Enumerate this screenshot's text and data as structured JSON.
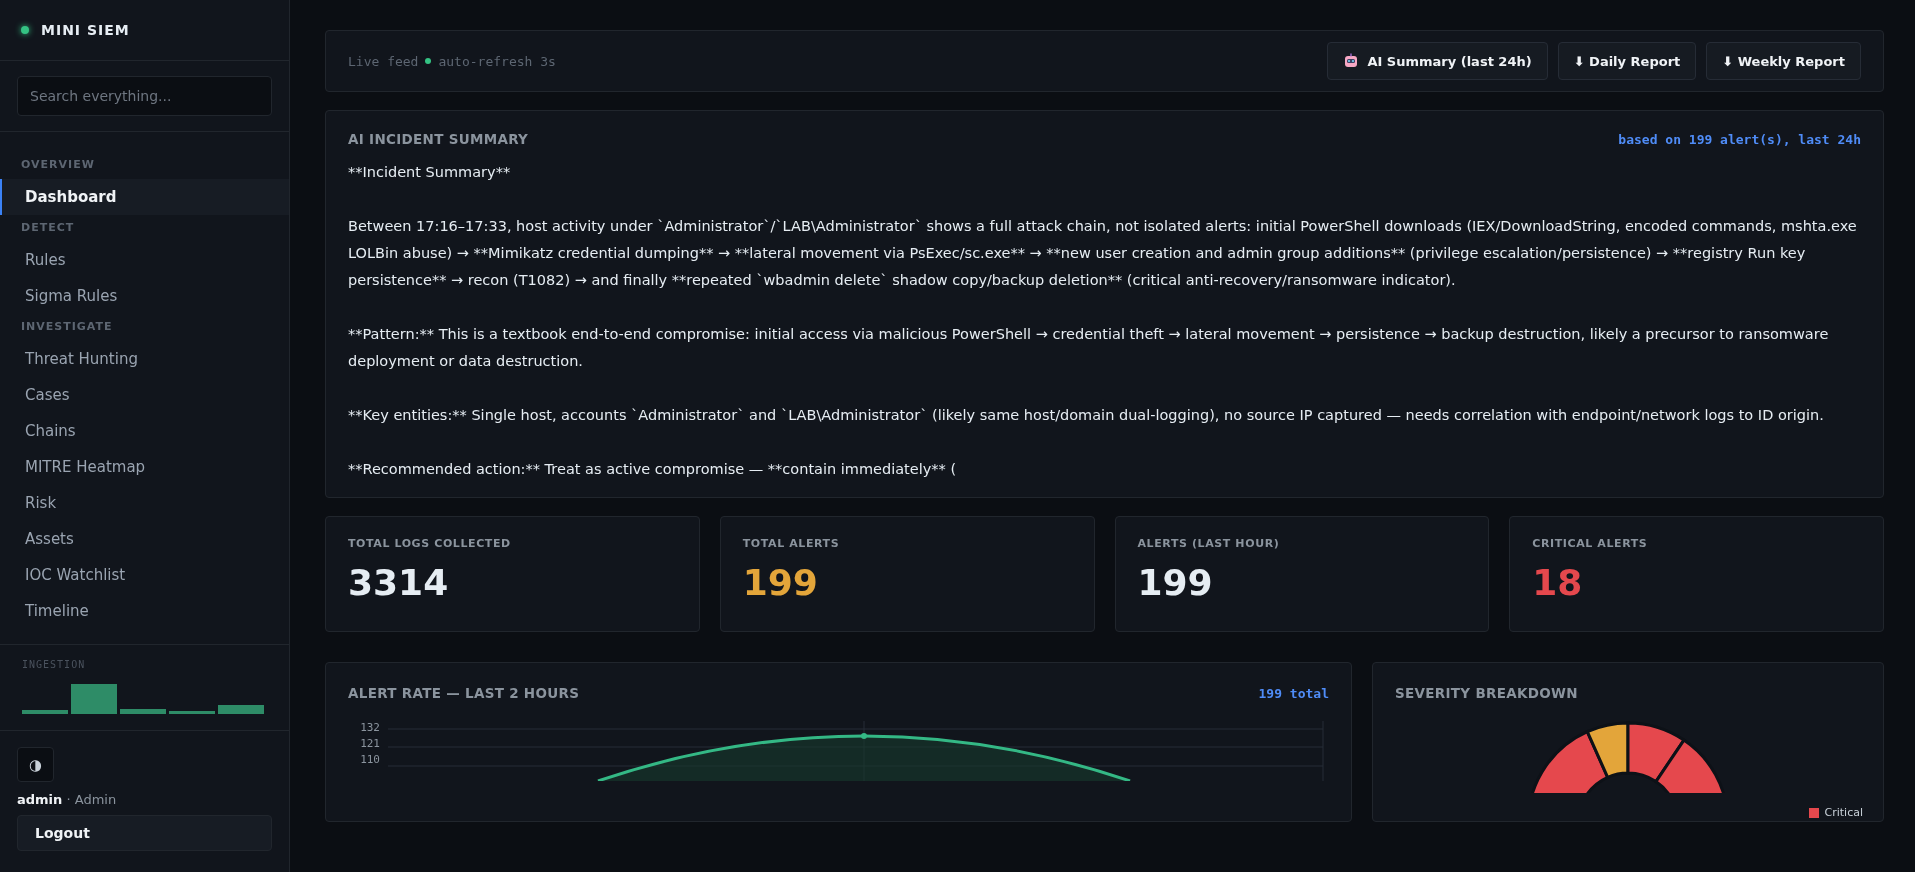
{
  "sidebar": {
    "brand": "MINI SIEM",
    "search": {
      "placeholder": "Search everything..."
    },
    "sections": [
      {
        "title": "OVERVIEW",
        "items": [
          {
            "label": "Dashboard",
            "selected": true
          }
        ]
      },
      {
        "title": "DETECT",
        "items": [
          {
            "label": "Rules",
            "selected": false
          },
          {
            "label": "Sigma Rules",
            "selected": false
          }
        ]
      },
      {
        "title": "INVESTIGATE",
        "items": [
          {
            "label": "Threat Hunting",
            "selected": false
          },
          {
            "label": "Cases",
            "selected": false
          },
          {
            "label": "Chains",
            "selected": false
          },
          {
            "label": "MITRE Heatmap",
            "selected": false
          },
          {
            "label": "Risk",
            "selected": false
          },
          {
            "label": "Assets",
            "selected": false
          },
          {
            "label": "IOC Watchlist",
            "selected": false
          },
          {
            "label": "Timeline",
            "selected": false
          }
        ]
      }
    ],
    "ingestion": {
      "title": "INGESTION"
    },
    "theme_toggle": "◑",
    "user": {
      "name": "admin",
      "role": "· Admin"
    },
    "logout": "Logout"
  },
  "top_bar": {
    "status_left": "Live feed",
    "status_right": "auto-refresh 3s",
    "buttons": [
      {
        "label": "AI Summary (last 24h)",
        "kind": "robot"
      },
      {
        "label": "⬇ Daily Report",
        "kind": "plain"
      },
      {
        "label": "⬇ Weekly Report",
        "kind": "plain"
      }
    ]
  },
  "ai_summary": {
    "title": "AI INCIDENT SUMMARY",
    "meta": "based on 199 alert(s), last 24h",
    "paragraphs": [
      "**Incident Summary**",
      "Between 17:16–17:33, host activity under `Administrator`/`LAB\\Administrator` shows a full attack chain, not isolated alerts: initial PowerShell downloads (IEX/DownloadString, encoded commands, mshta.exe LOLBin abuse) → **Mimikatz credential dumping** → **lateral movement via PsExec/sc.exe** → **new user creation and admin group additions** (privilege escalation/persistence) → **registry Run key persistence** → recon (T1082) → and finally **repeated `wbadmin delete` shadow copy/backup deletion** (critical anti-recovery/ransomware indicator).",
      "**Pattern:** This is a textbook end-to-end compromise: initial access via malicious PowerShell → credential theft → lateral movement → persistence → backup destruction, likely a precursor to ransomware deployment or data destruction.",
      "**Key entities:** Single host, accounts `Administrator` and `LAB\\Administrator` (likely same host/domain dual-logging), no source IP captured — needs correlation with endpoint/network logs to ID origin.",
      "**Recommended action:** Treat as active compromise — **contain immediately** ("
    ]
  },
  "stats": [
    {
      "label": "TOTAL LOGS COLLECTED",
      "value": "3314",
      "color": "#e6edf3"
    },
    {
      "label": "TOTAL ALERTS",
      "value": "199",
      "color": "#e3a53a"
    },
    {
      "label": "ALERTS (LAST HOUR)",
      "value": "199",
      "color": "#e6edf3"
    },
    {
      "label": "CRITICAL ALERTS",
      "value": "18",
      "color": "#e5484d"
    }
  ],
  "alert_rate": {
    "title": "ALERT RATE — LAST 2 HOURS",
    "total": "199 total",
    "y_labels": [
      "132",
      "121",
      "110"
    ]
  },
  "severity": {
    "title": "SEVERITY BREAKDOWN",
    "legend": [
      {
        "label": "Critical",
        "color": "#e5484d"
      }
    ]
  }
}
